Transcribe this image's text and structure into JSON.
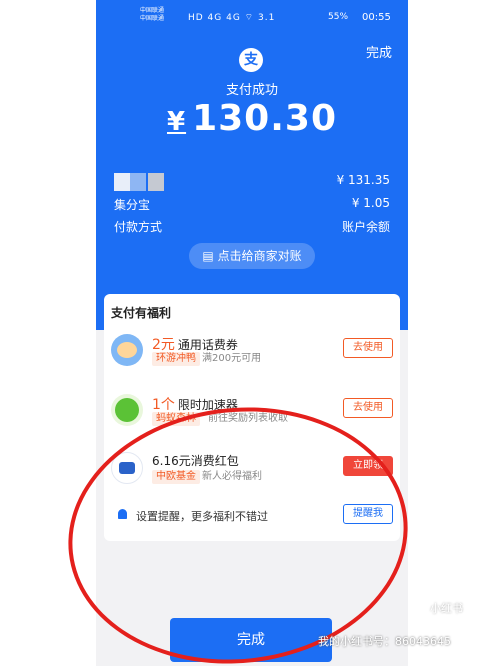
{
  "status_bar": {
    "carrier_1": "中国联通",
    "carrier_2": "中国联通",
    "icons": "HD 4G 4G ⌔ 3.1",
    "battery": "55%",
    "time": "00:55"
  },
  "header": {
    "done_link": "完成",
    "logo_glyph": "支",
    "title": "支付成功",
    "currency": "¥",
    "amount": "130.30"
  },
  "details": {
    "row1_right": "¥ 131.35",
    "row2_left": "集分宝",
    "row2_right": "¥ 1.05",
    "row3_left": "付款方式",
    "row3_right": "账户余额"
  },
  "reconcile_button": "点击给商家对账",
  "benefits": {
    "title": "支付有福利",
    "items": [
      {
        "num": "2元",
        "title": "通用话费券",
        "tag": "环游冲鸭",
        "desc": "满200元可用",
        "action": "去使用",
        "icon": "duck-icon"
      },
      {
        "num": "1个",
        "title": "限时加速器",
        "tag": "蚂蚁森林",
        "desc": "前往奖励列表收取",
        "action": "去使用",
        "icon": "green-energy-icon"
      },
      {
        "num": "",
        "title": "6.16元消费红包",
        "tag": "中欧基金",
        "desc": "新人必得福利",
        "action": "立即领",
        "icon": "fund-logo-icon"
      }
    ],
    "reminder_text": "设置提醒，更多福利不错过",
    "reminder_button": "提醒我"
  },
  "done_button": "完成",
  "watermark": "我的小红书号：86043645",
  "watermark_logo": "小红书",
  "colors": {
    "primary": "#1c6ef4",
    "accent": "#f25a25",
    "annotation": "#e4201c"
  }
}
